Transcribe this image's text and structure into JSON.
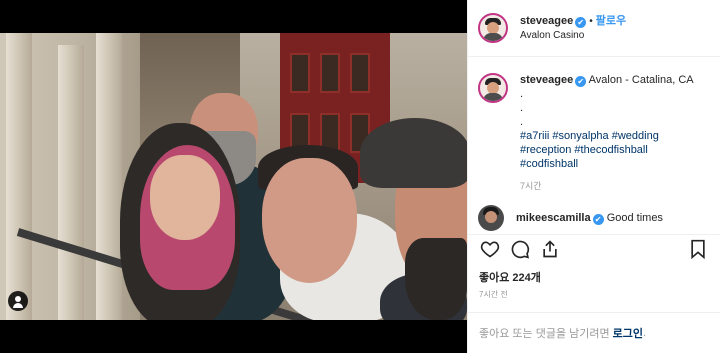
{
  "post": {
    "username": "steveagee",
    "follow_label": "팔로우",
    "location": "Avalon Casino",
    "dot": "•",
    "verified_mark": "✔"
  },
  "caption": {
    "username": "steveagee",
    "location_text": "Avalon - Catalina, CA",
    "dots": [
      ".",
      ".",
      "."
    ],
    "hashtags_line1": "#a7riii #sonyalpha #wedding",
    "hashtags_line2": "#reception #thecodfishball",
    "hashtags_line3": "#codfishball",
    "time": "7시간"
  },
  "comment": {
    "username": "mikeescamilla",
    "text": "Good times"
  },
  "actions": {
    "like_icon": "heart-icon",
    "comment_icon": "comment-bubble-icon",
    "share_icon": "share-icon",
    "save_icon": "bookmark-icon"
  },
  "stats": {
    "likes": "좋아요 224개",
    "time_ago": "7시간 전"
  },
  "footer": {
    "prompt": "좋아요 또는 댓글을 남기려면",
    "login_label": "로그인",
    "period": "."
  },
  "colors": {
    "link_blue": "#3897f0",
    "hashtag": "#003569",
    "muted": "#999999"
  }
}
